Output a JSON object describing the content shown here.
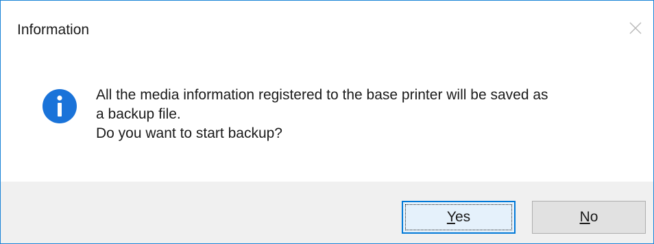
{
  "window": {
    "title": "Information"
  },
  "message": {
    "lines": [
      "All the media information registered to the base printer will be saved as",
      "a backup file.",
      "Do you want to start backup?"
    ]
  },
  "buttons": {
    "yes": {
      "accel": "Y",
      "rest": "es"
    },
    "no": {
      "accel": "N",
      "rest": "o"
    }
  },
  "colors": {
    "accent": "#0078d7",
    "icon_blue": "#1a73d9",
    "footer_bg": "#f0f0f0"
  },
  "icons": {
    "info": "info-icon",
    "close": "close-icon"
  }
}
